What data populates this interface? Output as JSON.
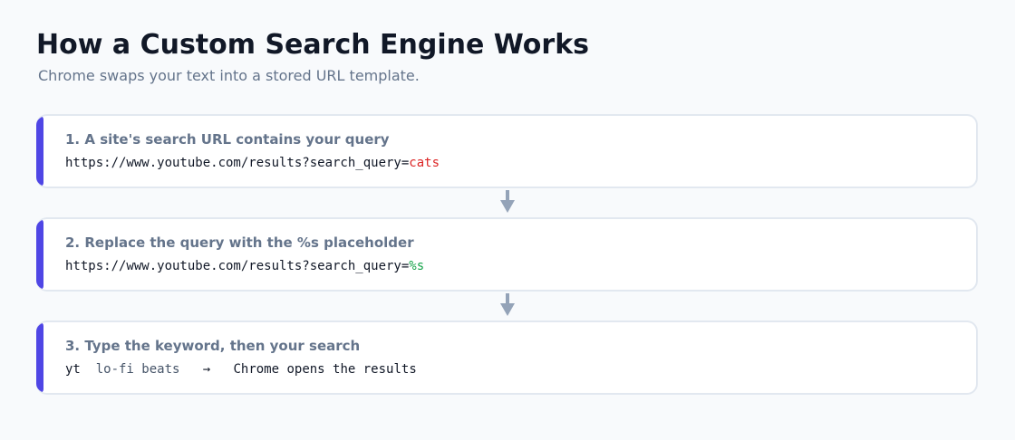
{
  "title": "How a Custom Search Engine Works",
  "subtitle": "Chrome swaps your text into a stored URL template.",
  "steps": [
    {
      "heading": "1.  A site's search URL contains your query",
      "url_base": "https://www.youtube.com/results?search_query=",
      "url_value": "cats"
    },
    {
      "heading": "2.  Replace the query with the %s placeholder",
      "url_base": "https://www.youtube.com/results?search_query=",
      "url_value": "%s"
    },
    {
      "heading": "3.  Type the keyword, then your search",
      "keyword": "yt",
      "query": "lo-fi beats",
      "arrow": "→",
      "result": "Chrome opens the results"
    }
  ],
  "colors": {
    "accent": "#4f46e5",
    "query_value": "#dc2626",
    "placeholder": "#16a34a",
    "connector_arrow": "#94a3b8"
  },
  "icons": [
    "down-arrow-icon",
    "down-arrow-icon"
  ]
}
